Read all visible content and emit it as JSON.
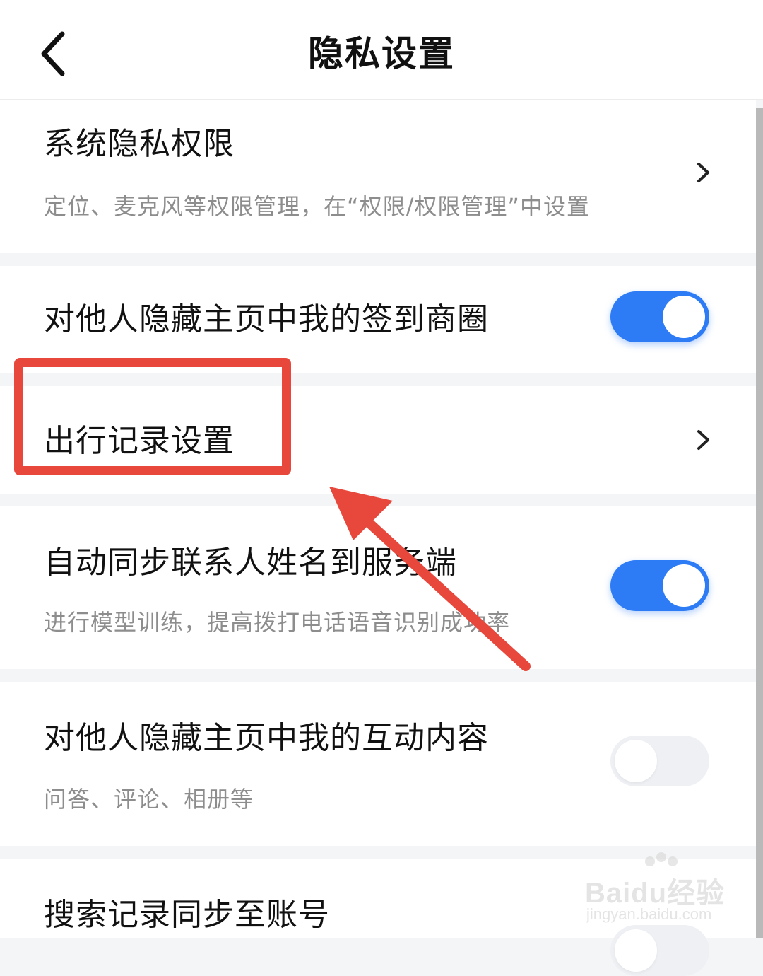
{
  "header": {
    "title": "隐私设置",
    "back_icon": "chevron-left-icon"
  },
  "rows": [
    {
      "title": "系统隐私权限",
      "subtitle": "定位、麦克风等权限管理，在“权限/权限管理”中设置",
      "control": "chevron-right-icon"
    },
    {
      "title": "对他人隐藏主页中我的签到商圈",
      "control": "toggle",
      "toggle_on": true
    },
    {
      "title": "出行记录设置",
      "control": "chevron-right-icon"
    },
    {
      "title": "自动同步联系人姓名到服务端",
      "subtitle": "进行模型训练，提高拨打电话语音识别成功率",
      "control": "toggle",
      "toggle_on": true
    },
    {
      "title": "对他人隐藏主页中我的互动内容",
      "subtitle": "问答、评论、相册等",
      "control": "toggle",
      "toggle_on": false
    },
    {
      "title": "搜索记录同步至账号",
      "control": "toggle"
    }
  ],
  "colors": {
    "accent": "#2d7cf6",
    "annotation": "#e8473c",
    "subtitle": "#8d8d8d"
  },
  "watermark": {
    "brand": "Baidu经验",
    "url": "jingyan.baidu.com"
  }
}
